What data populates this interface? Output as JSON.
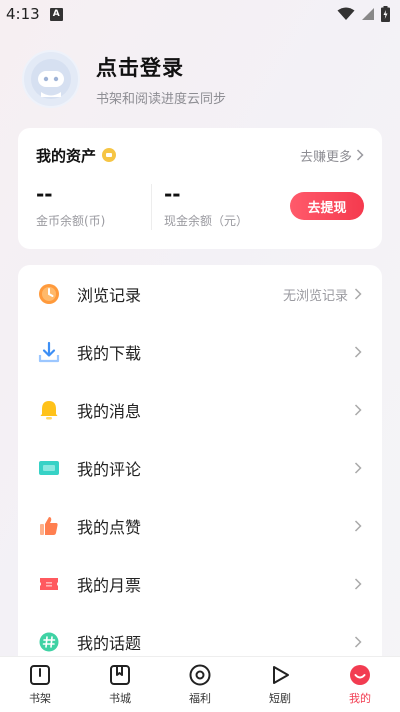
{
  "status_bar": {
    "time": "4:13",
    "a_badge": "A"
  },
  "profile": {
    "title": "点击登录",
    "subtitle": "书架和阅读进度云同步"
  },
  "assets": {
    "title": "我的资产",
    "earn_more": "去赚更多",
    "coin_balance_value": "--",
    "coin_balance_label": "金币余额(币)",
    "cash_balance_value": "--",
    "cash_balance_label": "现金余额（元）",
    "withdraw_label": "去提现"
  },
  "menu": {
    "items": [
      {
        "label": "浏览记录",
        "extra": "无浏览记录",
        "icon": "clock-icon"
      },
      {
        "label": "我的下载",
        "extra": "",
        "icon": "download-icon"
      },
      {
        "label": "我的消息",
        "extra": "",
        "icon": "bell-icon"
      },
      {
        "label": "我的评论",
        "extra": "",
        "icon": "comment-icon"
      },
      {
        "label": "我的点赞",
        "extra": "",
        "icon": "thumbs-up-icon"
      },
      {
        "label": "我的月票",
        "extra": "",
        "icon": "ticket-icon"
      },
      {
        "label": "我的话题",
        "extra": "",
        "icon": "hashtag-icon"
      }
    ]
  },
  "tabbar": {
    "tabs": [
      {
        "label": "书架",
        "icon": "bookshelf-icon"
      },
      {
        "label": "书城",
        "icon": "bookstore-icon"
      },
      {
        "label": "福利",
        "icon": "welfare-icon"
      },
      {
        "label": "短剧",
        "icon": "play-icon"
      },
      {
        "label": "我的",
        "icon": "profile-face-icon"
      }
    ],
    "active_index": 4
  },
  "colors": {
    "accent": "#f23c51",
    "muted_text": "#8d8d93"
  }
}
